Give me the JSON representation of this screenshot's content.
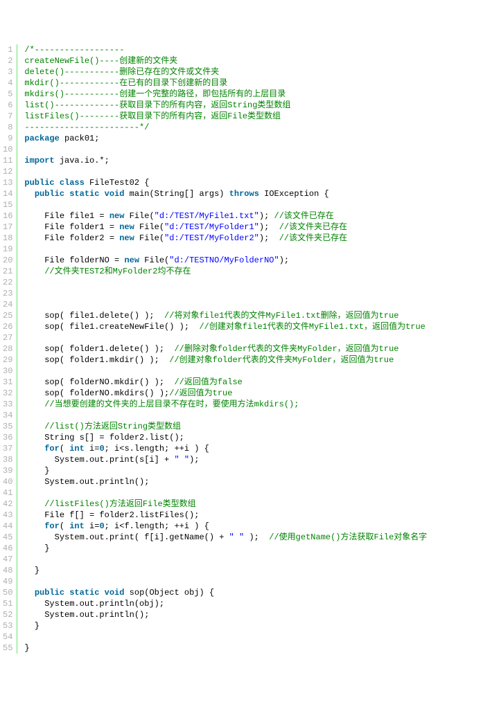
{
  "lines": [
    {
      "n": 1,
      "frags": [
        {
          "cls": "c",
          "t": "/*------------------"
        }
      ]
    },
    {
      "n": 2,
      "frags": [
        {
          "cls": "c",
          "t": "createNewFile()----创建新的文件夹"
        }
      ]
    },
    {
      "n": 3,
      "frags": [
        {
          "cls": "c",
          "t": "delete()-----------删除已存在的文件或文件夹"
        }
      ]
    },
    {
      "n": 4,
      "frags": [
        {
          "cls": "c",
          "t": "mkdir()------------在已有的目录下创建新的目录"
        }
      ]
    },
    {
      "n": 5,
      "frags": [
        {
          "cls": "c",
          "t": "mkdirs()-----------创建一个完整的路径，即包括所有的上层目录"
        }
      ]
    },
    {
      "n": 6,
      "frags": [
        {
          "cls": "c",
          "t": "list()-------------获取目录下的所有内容，返回String类型数组"
        }
      ]
    },
    {
      "n": 7,
      "frags": [
        {
          "cls": "c",
          "t": "listFiles()--------获取目录下的所有内容，返回File类型数组"
        }
      ]
    },
    {
      "n": 8,
      "frags": [
        {
          "cls": "c",
          "t": "-----------------------*/"
        }
      ]
    },
    {
      "n": 9,
      "frags": [
        {
          "cls": "k",
          "t": "package"
        },
        {
          "cls": "n",
          "t": " pack01;"
        }
      ]
    },
    {
      "n": 10,
      "frags": [
        {
          "cls": "n",
          "t": " "
        }
      ]
    },
    {
      "n": 11,
      "frags": [
        {
          "cls": "k",
          "t": "import"
        },
        {
          "cls": "n",
          "t": " java.io.*;"
        }
      ]
    },
    {
      "n": 12,
      "frags": [
        {
          "cls": "n",
          "t": " "
        }
      ]
    },
    {
      "n": 13,
      "frags": [
        {
          "cls": "k",
          "t": "public"
        },
        {
          "cls": "n",
          "t": " "
        },
        {
          "cls": "k",
          "t": "class"
        },
        {
          "cls": "n",
          "t": " FileTest02 {"
        }
      ]
    },
    {
      "n": 14,
      "frags": [
        {
          "cls": "n",
          "t": "  "
        },
        {
          "cls": "k",
          "t": "public"
        },
        {
          "cls": "n",
          "t": " "
        },
        {
          "cls": "k",
          "t": "static"
        },
        {
          "cls": "n",
          "t": " "
        },
        {
          "cls": "k",
          "t": "void"
        },
        {
          "cls": "n",
          "t": " main(String[] args) "
        },
        {
          "cls": "k",
          "t": "throws"
        },
        {
          "cls": "n",
          "t": " IOException {"
        }
      ]
    },
    {
      "n": 15,
      "frags": [
        {
          "cls": "n",
          "t": " "
        }
      ]
    },
    {
      "n": 16,
      "frags": [
        {
          "cls": "n",
          "t": "    File file1 = "
        },
        {
          "cls": "k",
          "t": "new"
        },
        {
          "cls": "n",
          "t": " File("
        },
        {
          "cls": "s",
          "t": "\"d:/TEST/MyFile1.txt\""
        },
        {
          "cls": "n",
          "t": "); "
        },
        {
          "cls": "c",
          "t": "//该文件已存在"
        }
      ]
    },
    {
      "n": 17,
      "frags": [
        {
          "cls": "n",
          "t": "    File folder1 = "
        },
        {
          "cls": "k",
          "t": "new"
        },
        {
          "cls": "n",
          "t": " File("
        },
        {
          "cls": "s",
          "t": "\"d:/TEST/MyFolder1\""
        },
        {
          "cls": "n",
          "t": ");  "
        },
        {
          "cls": "c",
          "t": "//该文件夹已存在"
        }
      ]
    },
    {
      "n": 18,
      "frags": [
        {
          "cls": "n",
          "t": "    File folder2 = "
        },
        {
          "cls": "k",
          "t": "new"
        },
        {
          "cls": "n",
          "t": " File("
        },
        {
          "cls": "s",
          "t": "\"d:/TEST/MyFolder2\""
        },
        {
          "cls": "n",
          "t": ");  "
        },
        {
          "cls": "c",
          "t": "//该文件夹已存在"
        }
      ]
    },
    {
      "n": 19,
      "frags": [
        {
          "cls": "n",
          "t": " "
        }
      ]
    },
    {
      "n": 20,
      "frags": [
        {
          "cls": "n",
          "t": "    File folderNO = "
        },
        {
          "cls": "k",
          "t": "new"
        },
        {
          "cls": "n",
          "t": " File("
        },
        {
          "cls": "s",
          "t": "\"d:/TESTNO/MyFolderNO\""
        },
        {
          "cls": "n",
          "t": ");"
        }
      ]
    },
    {
      "n": 21,
      "frags": [
        {
          "cls": "n",
          "t": "    "
        },
        {
          "cls": "c",
          "t": "//文件夹TEST2和MyFolder2均不存在"
        }
      ]
    },
    {
      "n": 22,
      "frags": [
        {
          "cls": "n",
          "t": " "
        }
      ]
    },
    {
      "n": 23,
      "frags": [
        {
          "cls": "n",
          "t": " "
        }
      ]
    },
    {
      "n": 24,
      "frags": [
        {
          "cls": "n",
          "t": " "
        }
      ]
    },
    {
      "n": 25,
      "frags": [
        {
          "cls": "n",
          "t": "    sop( file1.delete() );  "
        },
        {
          "cls": "c",
          "t": "//将对象file1代表的文件MyFile1.txt删除，返回值为true"
        }
      ]
    },
    {
      "n": 26,
      "frags": [
        {
          "cls": "n",
          "t": "    sop( file1.createNewFile() );  "
        },
        {
          "cls": "c",
          "t": "//创建对象file1代表的文件MyFile1.txt，返回值为true"
        }
      ]
    },
    {
      "n": 27,
      "frags": [
        {
          "cls": "n",
          "t": " "
        }
      ]
    },
    {
      "n": 28,
      "frags": [
        {
          "cls": "n",
          "t": "    sop( folder1.delete() );  "
        },
        {
          "cls": "c",
          "t": "//删除对象folder代表的文件夹MyFolder，返回值为true"
        }
      ]
    },
    {
      "n": 29,
      "frags": [
        {
          "cls": "n",
          "t": "    sop( folder1.mkdir() );  "
        },
        {
          "cls": "c",
          "t": "//创建对象folder代表的文件夹MyFolder，返回值为true"
        }
      ]
    },
    {
      "n": 30,
      "frags": [
        {
          "cls": "n",
          "t": " "
        }
      ]
    },
    {
      "n": 31,
      "frags": [
        {
          "cls": "n",
          "t": "    sop( folderNO.mkdir() );  "
        },
        {
          "cls": "c",
          "t": "//返回值为false"
        }
      ]
    },
    {
      "n": 32,
      "frags": [
        {
          "cls": "n",
          "t": "    sop( folderNO.mkdirs() );"
        },
        {
          "cls": "c",
          "t": "//返回值为true"
        }
      ]
    },
    {
      "n": 33,
      "frags": [
        {
          "cls": "n",
          "t": "    "
        },
        {
          "cls": "c",
          "t": "//当想要创建的文件夹的上层目录不存在时，要使用方法mkdirs();"
        }
      ]
    },
    {
      "n": 34,
      "frags": [
        {
          "cls": "n",
          "t": " "
        }
      ]
    },
    {
      "n": 35,
      "frags": [
        {
          "cls": "n",
          "t": "    "
        },
        {
          "cls": "c",
          "t": "//list()方法返回String类型数组"
        }
      ]
    },
    {
      "n": 36,
      "frags": [
        {
          "cls": "n",
          "t": "    String s[] = folder2.list();"
        }
      ]
    },
    {
      "n": 37,
      "frags": [
        {
          "cls": "n",
          "t": "    "
        },
        {
          "cls": "k",
          "t": "for"
        },
        {
          "cls": "n",
          "t": "( "
        },
        {
          "cls": "k",
          "t": "int"
        },
        {
          "cls": "n",
          "t": " i="
        },
        {
          "cls": "k",
          "t": "0"
        },
        {
          "cls": "n",
          "t": "; i<s.length; ++i ) {"
        }
      ]
    },
    {
      "n": 38,
      "frags": [
        {
          "cls": "n",
          "t": "      System.out.print(s[i] + "
        },
        {
          "cls": "s",
          "t": "\" \""
        },
        {
          "cls": "n",
          "t": ");"
        }
      ]
    },
    {
      "n": 39,
      "frags": [
        {
          "cls": "n",
          "t": "    }"
        }
      ]
    },
    {
      "n": 40,
      "frags": [
        {
          "cls": "n",
          "t": "    System.out.println();"
        }
      ]
    },
    {
      "n": 41,
      "frags": [
        {
          "cls": "n",
          "t": " "
        }
      ]
    },
    {
      "n": 42,
      "frags": [
        {
          "cls": "n",
          "t": "    "
        },
        {
          "cls": "c",
          "t": "//listFiles()方法返回File类型数组"
        }
      ]
    },
    {
      "n": 43,
      "frags": [
        {
          "cls": "n",
          "t": "    File f[] = folder2.listFiles();"
        }
      ]
    },
    {
      "n": 44,
      "frags": [
        {
          "cls": "n",
          "t": "    "
        },
        {
          "cls": "k",
          "t": "for"
        },
        {
          "cls": "n",
          "t": "( "
        },
        {
          "cls": "k",
          "t": "int"
        },
        {
          "cls": "n",
          "t": " i="
        },
        {
          "cls": "k",
          "t": "0"
        },
        {
          "cls": "n",
          "t": "; i<f.length; ++i ) {"
        }
      ]
    },
    {
      "n": 45,
      "frags": [
        {
          "cls": "n",
          "t": "      System.out.print( f[i].getName() + "
        },
        {
          "cls": "s",
          "t": "\" \""
        },
        {
          "cls": "n",
          "t": " );  "
        },
        {
          "cls": "c",
          "t": "//使用getName()方法获取File对象名字"
        }
      ]
    },
    {
      "n": 46,
      "frags": [
        {
          "cls": "n",
          "t": "    }"
        }
      ]
    },
    {
      "n": 47,
      "frags": [
        {
          "cls": "n",
          "t": " "
        }
      ]
    },
    {
      "n": 48,
      "frags": [
        {
          "cls": "n",
          "t": "  }"
        }
      ]
    },
    {
      "n": 49,
      "frags": [
        {
          "cls": "n",
          "t": " "
        }
      ]
    },
    {
      "n": 50,
      "frags": [
        {
          "cls": "n",
          "t": "  "
        },
        {
          "cls": "k",
          "t": "public"
        },
        {
          "cls": "n",
          "t": " "
        },
        {
          "cls": "k",
          "t": "static"
        },
        {
          "cls": "n",
          "t": " "
        },
        {
          "cls": "k",
          "t": "void"
        },
        {
          "cls": "n",
          "t": " sop(Object obj) {"
        }
      ]
    },
    {
      "n": 51,
      "frags": [
        {
          "cls": "n",
          "t": "    System.out.println(obj);"
        }
      ]
    },
    {
      "n": 52,
      "frags": [
        {
          "cls": "n",
          "t": "    System.out.println();"
        }
      ]
    },
    {
      "n": 53,
      "frags": [
        {
          "cls": "n",
          "t": "  }"
        }
      ]
    },
    {
      "n": 54,
      "frags": [
        {
          "cls": "n",
          "t": " "
        }
      ]
    },
    {
      "n": 55,
      "frags": [
        {
          "cls": "n",
          "t": "}"
        }
      ]
    }
  ]
}
